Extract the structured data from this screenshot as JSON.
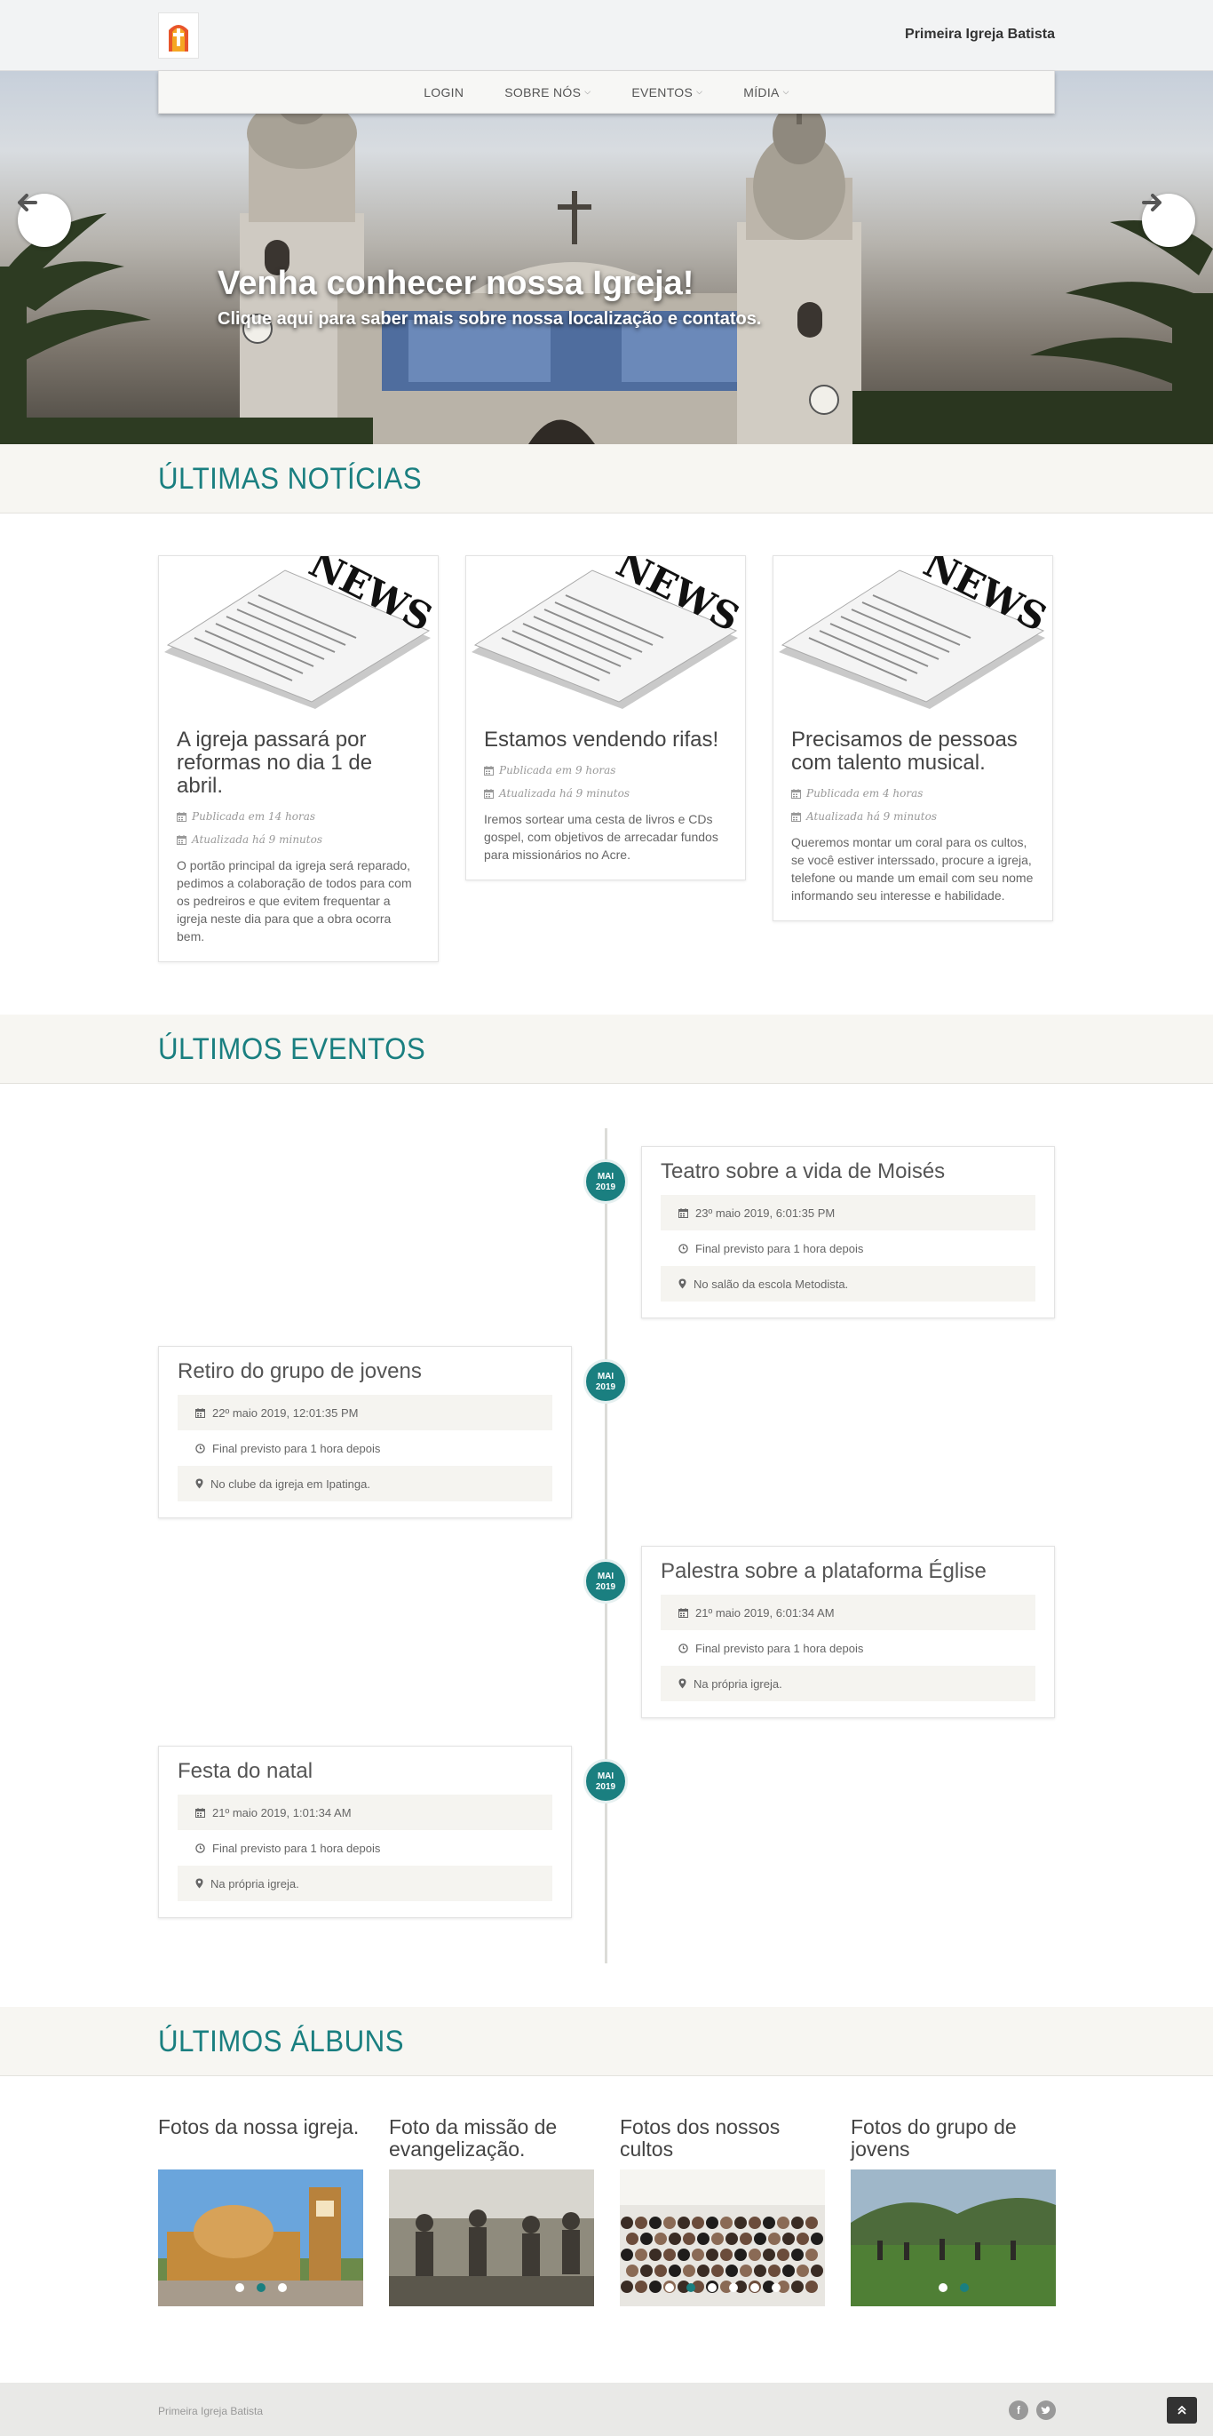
{
  "header": {
    "brand": "Primeira Igreja Batista",
    "nav": [
      {
        "label": "LOGIN",
        "has_caret": false
      },
      {
        "label": "SOBRE NÓS",
        "has_caret": true
      },
      {
        "label": "EVENTOS",
        "has_caret": true
      },
      {
        "label": "MÍDIA",
        "has_caret": true
      }
    ]
  },
  "hero": {
    "title": "Venha conhecer nossa Igreja!",
    "subtitle": "Clique aqui para saber mais sobre nossa localização e contatos."
  },
  "news": {
    "heading": "ÚLTIMAS NOTÍCIAS",
    "items": [
      {
        "title": "A igreja passará por reformas no dia 1 de abril.",
        "published": "Publicada em 14 horas",
        "updated": "Atualizada há 9 minutos",
        "text": "O portão principal da igreja será reparado, pedimos a colaboração de todos para com os pedreiros e que evitem frequentar a igreja neste dia para que a obra ocorra bem."
      },
      {
        "title": "Estamos vendendo rifas!",
        "published": "Publicada em 9 horas",
        "updated": "Atualizada há 9 minutos",
        "text": "Iremos sortear uma cesta de livros e CDs gospel, com objetivos de arrecadar fundos para missionários no Acre."
      },
      {
        "title": "Precisamos de pessoas com talento musical.",
        "published": "Publicada em 4 horas",
        "updated": "Atualizada há 9 minutos",
        "text": "Queremos montar um coral para os cultos, se você estiver interssado, procure a igreja, telefone ou mande um email com seu nome informando seu interesse e habilidade."
      }
    ]
  },
  "events": {
    "heading": "ÚLTIMOS EVENTOS",
    "items": [
      {
        "badge_month": "MAI",
        "badge_year": "2019",
        "title": "Teatro sobre a vida de Moisés",
        "date": "23º maio 2019, 6:01:35 PM",
        "duration": "Final previsto para 1 hora depois",
        "location": "No salão da escola Metodista."
      },
      {
        "badge_month": "MAI",
        "badge_year": "2019",
        "title": "Retiro do grupo de jovens",
        "date": "22º maio 2019, 12:01:35 PM",
        "duration": "Final previsto para 1 hora depois",
        "location": "No clube da igreja em Ipatinga."
      },
      {
        "badge_month": "MAI",
        "badge_year": "2019",
        "title": "Palestra sobre a plataforma Église",
        "date": "21º maio 2019, 6:01:34 AM",
        "duration": "Final previsto para 1 hora depois",
        "location": "Na própria igreja."
      },
      {
        "badge_month": "MAI",
        "badge_year": "2019",
        "title": "Festa do natal",
        "date": "21º maio 2019, 1:01:34 AM",
        "duration": "Final previsto para 1 hora depois",
        "location": "Na própria igreja."
      }
    ]
  },
  "albums": {
    "heading": "ÚLTIMOS ÁLBUNS",
    "items": [
      {
        "title": "Fotos da nossa igreja.",
        "dots": 3,
        "active_dot": 1
      },
      {
        "title": "Foto da missão de evangelização.",
        "dots": 0,
        "active_dot": -1
      },
      {
        "title": "Fotos dos nossos cultos",
        "dots": 6,
        "active_dot": 1
      },
      {
        "title": "Fotos do grupo de jovens",
        "dots": 2,
        "active_dot": 1
      }
    ]
  },
  "footer": {
    "text": "Primeira Igreja Batista",
    "social": [
      "facebook-icon",
      "twitter-icon"
    ]
  },
  "colors": {
    "accent": "#1a7f80",
    "band": "#f7f6f2"
  }
}
